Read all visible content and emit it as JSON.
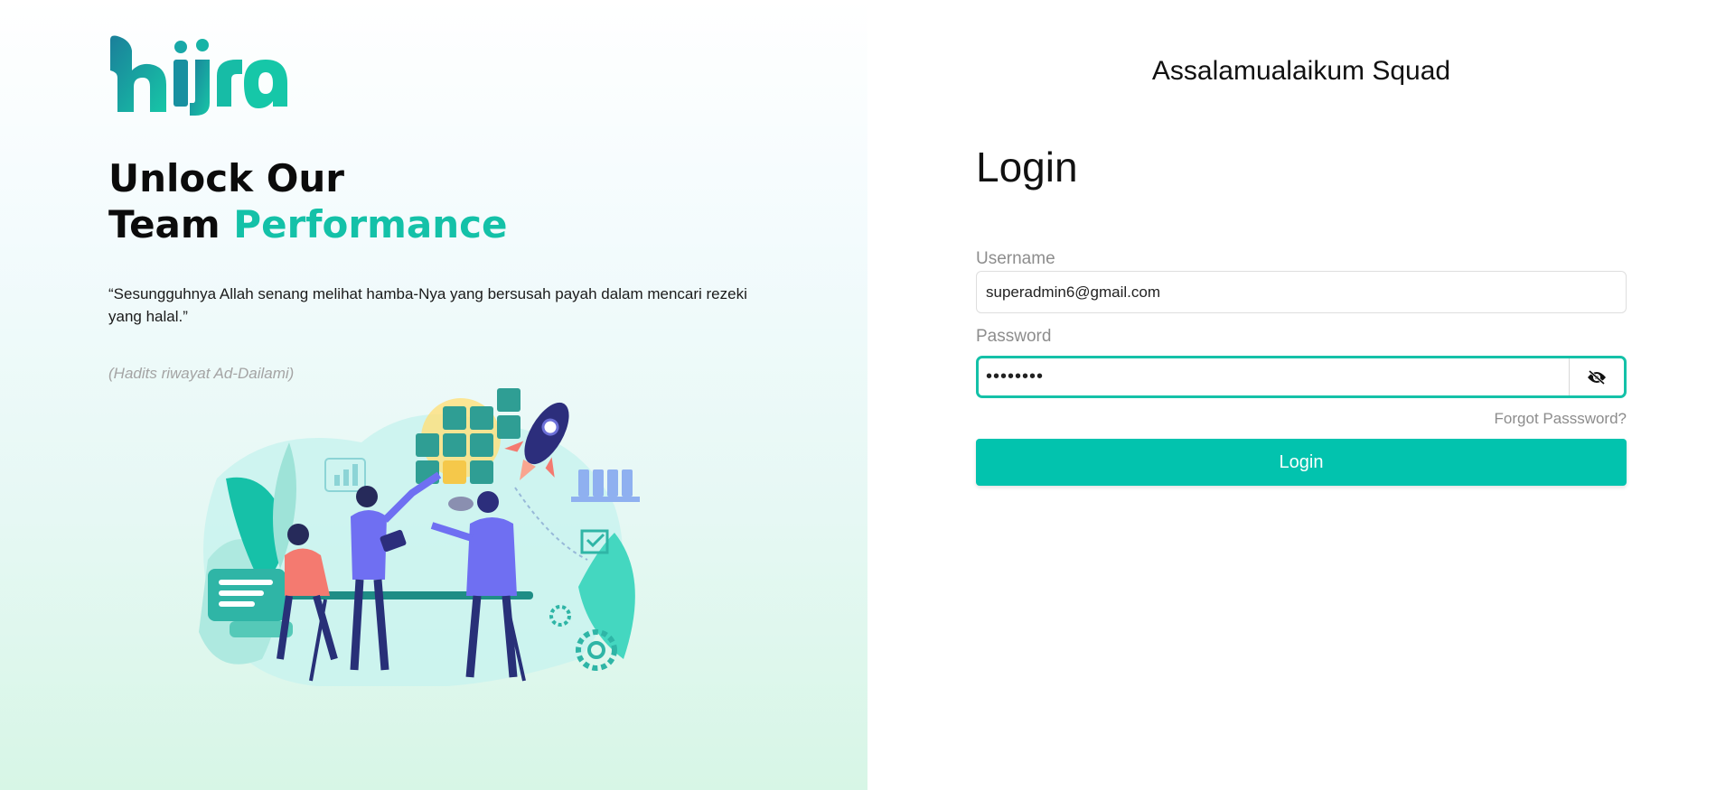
{
  "brand": {
    "logo_text": "hijra",
    "accent_color": "#14c1a8",
    "button_color": "#02c3ae"
  },
  "hero": {
    "headline_line1": "Unlock Our",
    "headline_line2_plain": "Team",
    "headline_line2_accent": "Performance",
    "quote": "“Sesungguhnya Allah senang melihat hamba-Nya yang bersusah payah dalam mencari rezeki yang halal.”",
    "citation": "(Hadits riwayat Ad-Dailami)",
    "illustration": "team-puzzle-illustration"
  },
  "login": {
    "greeting": "Assalamualaikum Squad",
    "title": "Login",
    "username_label": "Username",
    "username_value": "superadmin6@gmail.com",
    "password_label": "Password",
    "password_value": "password",
    "password_toggle_icon": "eye-off-icon",
    "forgot_link": "Forgot Passsword?",
    "submit_label": "Login"
  }
}
